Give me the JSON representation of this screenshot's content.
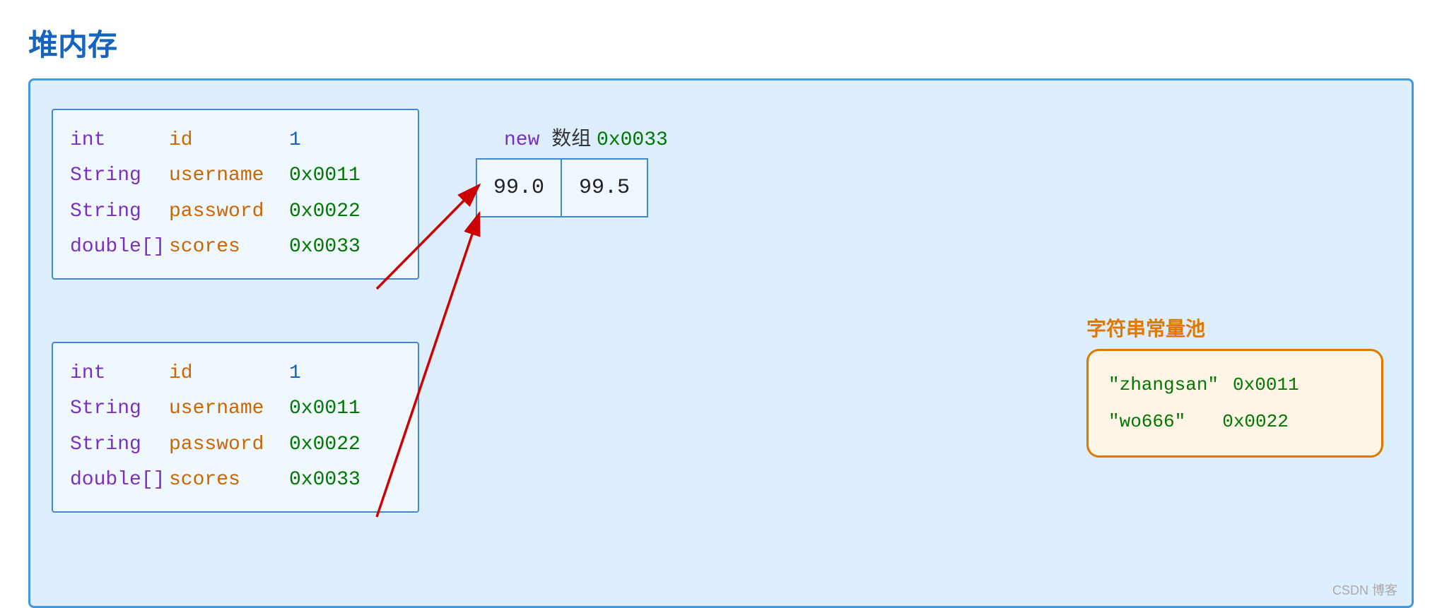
{
  "page": {
    "title": "堆内存",
    "watermark": "CSDN 博客"
  },
  "heap": {
    "background_color": "#DDEEFF",
    "border_color": "#4499DD"
  },
  "object1": {
    "fields": [
      {
        "type": "int",
        "name": "id",
        "value": "1",
        "value_type": "int"
      },
      {
        "type": "String",
        "name": "username",
        "value": "0x0011",
        "value_type": "hex"
      },
      {
        "type": "String",
        "name": "password",
        "value": "0x0022",
        "value_type": "hex"
      },
      {
        "type": "double[]",
        "name": "scores",
        "value": "0x0033",
        "value_type": "hex"
      }
    ]
  },
  "object2": {
    "fields": [
      {
        "type": "int",
        "name": "id",
        "value": "1",
        "value_type": "int"
      },
      {
        "type": "String",
        "name": "username",
        "value": "0x0011",
        "value_type": "hex"
      },
      {
        "type": "String",
        "name": "password",
        "value": "0x0022",
        "value_type": "hex"
      },
      {
        "type": "double[]",
        "name": "scores",
        "value": "0x0033",
        "value_type": "hex"
      }
    ]
  },
  "array": {
    "label_new": "new",
    "label_array": "数组",
    "label_addr": "0x0033",
    "cells": [
      "99.0",
      "99.5"
    ]
  },
  "string_pool": {
    "title": "字符串常量池",
    "entries": [
      {
        "string": "\"zhangsan\"",
        "addr": "0x0011"
      },
      {
        "string": "\"wo666\"",
        "addr": "0x0022"
      }
    ]
  }
}
